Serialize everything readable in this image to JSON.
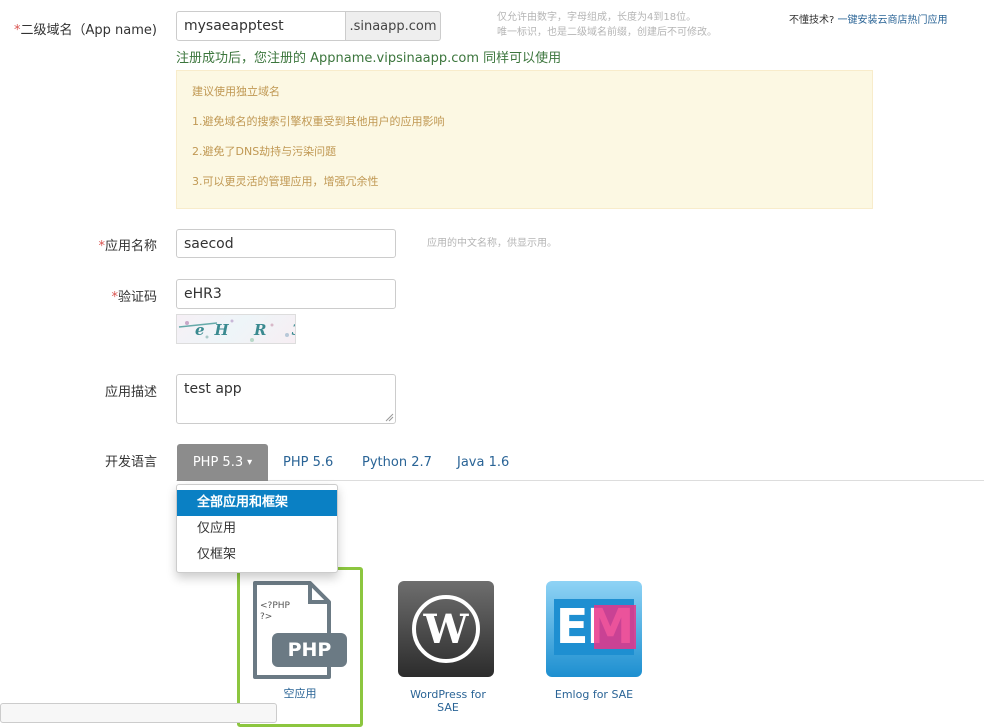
{
  "form": {
    "domain": {
      "required_mark": "*",
      "label": "二级域名（App name)",
      "value": "mysaeapptest",
      "suffix": ".sinaapp.com",
      "hint_line1": "仅允许由数字，字母组成，长度为4到18位。",
      "hint_line2": "唯一标识，也是二级域名前缀，创建后不可修改。",
      "success": "注册成功后，您注册的 Appname.vipsinaapp.com 同样可以使用"
    },
    "top_right": {
      "text": "不懂技术?",
      "link": "一键安装云商店热门应用"
    },
    "tips": {
      "title": "建议使用独立域名",
      "items": [
        "1.避免域名的搜索引擎权重受到其他用户的应用影响",
        "2.避免了DNS劫持与污染问题",
        "3.可以更灵活的管理应用，增强冗余性"
      ]
    },
    "app_name": {
      "required_mark": "*",
      "label": "应用名称",
      "value": "saecod",
      "hint": "应用的中文名称，供显示用。"
    },
    "captcha": {
      "required_mark": "*",
      "label": "验证码",
      "value": "eHR3",
      "image_text": "eH R 3"
    },
    "description": {
      "label": "应用描述",
      "value": "test app"
    },
    "language": {
      "label": "开发语言",
      "tabs": [
        "PHP 5.3",
        "PHP 5.6",
        "Python 2.7",
        "Java 1.6"
      ],
      "caret": "▾"
    },
    "dropdown": {
      "items": [
        "全部应用和框架",
        "仅应用",
        "仅框架"
      ],
      "selected": 0
    },
    "apps": [
      {
        "name": "空应用",
        "icon_text_top": "<?PHP\n?>",
        "icon_badge": "PHP"
      },
      {
        "name": "WordPress for SAE",
        "name_line1": "WordPress for",
        "name_line2": "SAE",
        "icon_letter": "W"
      },
      {
        "name": "Emlog for SAE",
        "icon_text": "EM"
      }
    ]
  },
  "colors": {
    "accent_blue": "#0a80c4",
    "link": "#2a6496",
    "success_green": "#3c763d",
    "warning_bg": "#fcf8e3",
    "selected_border": "#8cc63f"
  }
}
